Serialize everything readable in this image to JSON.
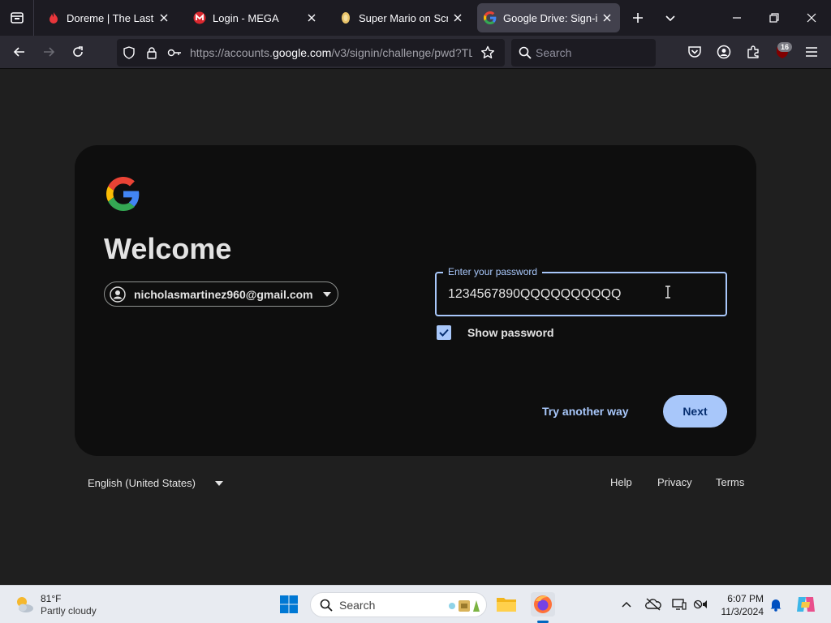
{
  "browser": {
    "tabs": [
      {
        "title": "Doreme | The Last Universe",
        "favicon": "doreme-flame-icon",
        "active": false
      },
      {
        "title": "Login - MEGA",
        "favicon": "mega-logo-icon",
        "active": false
      },
      {
        "title": "Super Mario on Scratch",
        "favicon": "scratch-cat-icon",
        "active": false
      },
      {
        "title": "Google Drive: Sign-in",
        "favicon": "google-g-icon",
        "active": true
      }
    ],
    "url": {
      "prefix": "https://accounts.",
      "domain": "google.com",
      "path": "/v3/signin/challenge/pwd?TL"
    },
    "search_placeholder": "Search",
    "extension_badge": "16"
  },
  "signin": {
    "heading": "Welcome",
    "account_email": "nicholasmartinez960@gmail.com",
    "password_label": "Enter your password",
    "password_value": "1234567890QQQQQQQQQQ",
    "show_password_label": "Show password",
    "show_password_checked": true,
    "try_another_label": "Try another way",
    "next_label": "Next"
  },
  "footer": {
    "language": "English (United States)",
    "links": {
      "help": "Help",
      "privacy": "Privacy",
      "terms": "Terms"
    }
  },
  "taskbar": {
    "weather": {
      "temp": "81°F",
      "desc": "Partly cloudy"
    },
    "search_placeholder": "Search",
    "clock": {
      "time": "6:07 PM",
      "date": "11/3/2024"
    }
  },
  "colors": {
    "accent": "#a8c7fa",
    "card_bg": "#0e0e0e",
    "page_bg": "#1f1f1f",
    "next_text": "#062e6f"
  }
}
